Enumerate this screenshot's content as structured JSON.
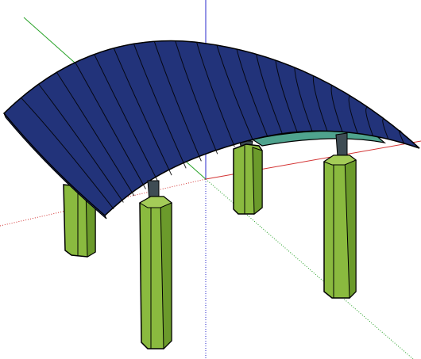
{
  "model": {
    "name": "",
    "components": [
      "axes",
      "curved-roof",
      "pillars"
    ]
  },
  "colors": {
    "background": "#ffffff",
    "roof": "#22337a",
    "roof_dark": "#1a2a66",
    "roof_underside": "#4fa38e",
    "roof_panel_line": "#000000",
    "pillar": "#8aba3f",
    "pillar_shade": "#6b9a2b",
    "pillar_light": "#a4cc58",
    "outline": "#000000",
    "axis_red": "#d33333",
    "axis_green": "#2aa32a",
    "axis_blue": "#2a2acc"
  },
  "icons": {
    "axes": "3d-axes-icon"
  }
}
